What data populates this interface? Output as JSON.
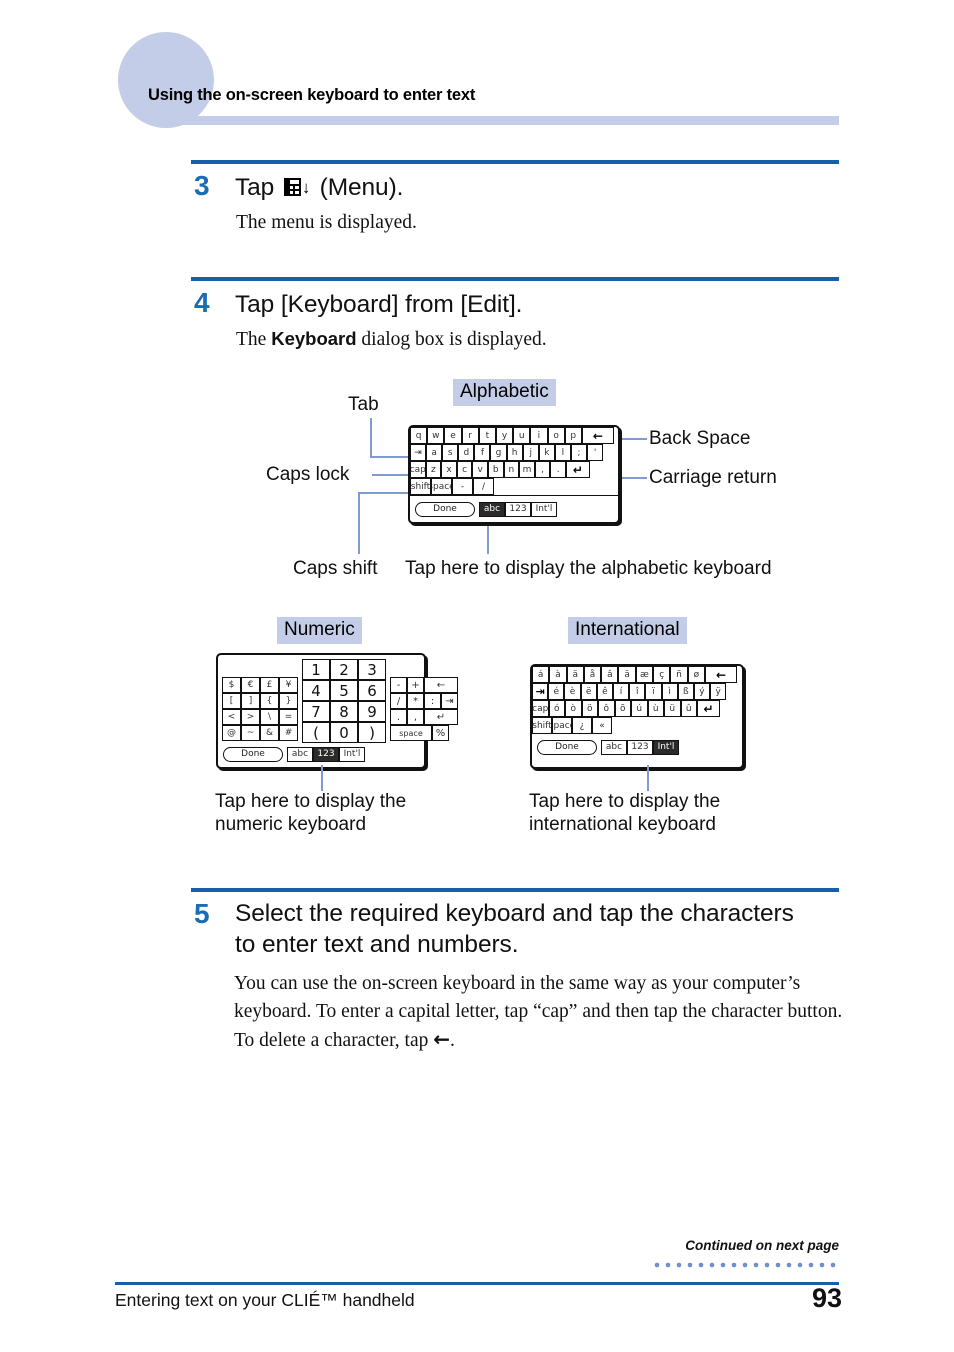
{
  "header": {
    "title": "Using the on-screen keyboard to enter text"
  },
  "steps": [
    {
      "number": "3",
      "heading_before": "Tap",
      "heading_icon": "menu-icon",
      "heading_after": "(Menu).",
      "body": "The menu is displayed."
    },
    {
      "number": "4",
      "heading": "Tap [Keyboard] from [Edit].",
      "body_pre": "The ",
      "body_bold": "Keyboard",
      "body_post": " dialog box is displayed."
    },
    {
      "number": "5",
      "heading": "Select the required keyboard and tap the characters to enter text and numbers.",
      "body_pre": "You can use the on-screen keyboard in the same way as your computer’s keyboard. To enter a capital letter, tap “cap” and then tap the character button. To delete a character, tap ",
      "body_arrow": "←",
      "body_post": "."
    }
  ],
  "diagram": {
    "labels": {
      "alphabetic": "Alphabetic",
      "numeric": "Numeric",
      "international": "International"
    },
    "annotations": {
      "tab": "Tab",
      "caps_lock": "Caps lock",
      "caps_shift": "Caps shift",
      "back_space": "Back Space",
      "carriage_return": "Carriage return",
      "tap_alpha": "Tap here to display the alphabetic keyboard",
      "tap_numeric_l1": "Tap here to display the",
      "tap_numeric_l2": "numeric keyboard",
      "tap_intl_l1": "Tap here to display the",
      "tap_intl_l2": "international keyboard"
    }
  },
  "keyboards": {
    "alphabetic": {
      "row1": [
        "q",
        "w",
        "e",
        "r",
        "t",
        "y",
        "u",
        "i",
        "o",
        "p"
      ],
      "row1_special": "←",
      "row2_tab": "⇥",
      "row2": [
        "a",
        "s",
        "d",
        "f",
        "g",
        "h",
        "j",
        "k",
        "l",
        ";",
        "'"
      ],
      "row3_cap": "cap",
      "row3": [
        "z",
        "x",
        "c",
        "v",
        "b",
        "n",
        "m",
        ",",
        "."
      ],
      "row3_special": "↵",
      "row4_shift": "shift",
      "row4_space": "space",
      "row4": [
        "-",
        "/"
      ],
      "bottom": {
        "done": "Done",
        "abc": "abc",
        "num": "123",
        "intl": "Int'l",
        "selected": "abc"
      }
    },
    "numeric": {
      "symbols": [
        [
          "$",
          "€",
          "£",
          "¥"
        ],
        [
          "[",
          "]",
          "{",
          "}"
        ],
        [
          "<",
          ">",
          "\\",
          "="
        ],
        [
          "@",
          "~",
          "&",
          "#"
        ]
      ],
      "digits": [
        [
          "1",
          "2",
          "3"
        ],
        [
          "4",
          "5",
          "6"
        ],
        [
          "7",
          "8",
          "9"
        ],
        [
          "(",
          "0",
          ")"
        ]
      ],
      "ops": [
        [
          "-",
          "+",
          "←"
        ],
        [
          "/",
          "*",
          ":",
          "⇥"
        ],
        [
          ".",
          ",",
          "↵"
        ],
        [
          "space",
          "%"
        ]
      ],
      "bottom": {
        "done": "Done",
        "abc": "abc",
        "num": "123",
        "intl": "Int'l",
        "selected": "123"
      }
    },
    "international": {
      "row1": [
        "á",
        "à",
        "ä",
        "å",
        "â",
        "ā",
        "æ",
        "ç",
        "ñ",
        "ø"
      ],
      "row1_special": "←",
      "row2_tab": "⇥",
      "row2": [
        "é",
        "è",
        "ë",
        "ê",
        "í",
        "î",
        "ï",
        "ì",
        "ß",
        "ý",
        "ÿ"
      ],
      "row3_cap": "cap",
      "row3": [
        "ó",
        "ò",
        "ö",
        "ô",
        "õ",
        "ú",
        "ù",
        "ü",
        "û"
      ],
      "row3_special": "↵",
      "row4_shift": "shift",
      "row4_space": "space",
      "row4": [
        "¿",
        "«"
      ],
      "bottom": {
        "done": "Done",
        "abc": "abc",
        "num": "123",
        "intl": "Int'l",
        "selected": "Int'l"
      }
    }
  },
  "footer": {
    "continued": "Continued on next page",
    "section": "Entering text on your CLIÉ™ handheld",
    "page_number": "93"
  },
  "colors": {
    "accent_blue": "#1560a8",
    "step_number_blue": "#1a6cb5",
    "lavender": "#c3cde8",
    "leader_blue": "#7f9bd1"
  }
}
